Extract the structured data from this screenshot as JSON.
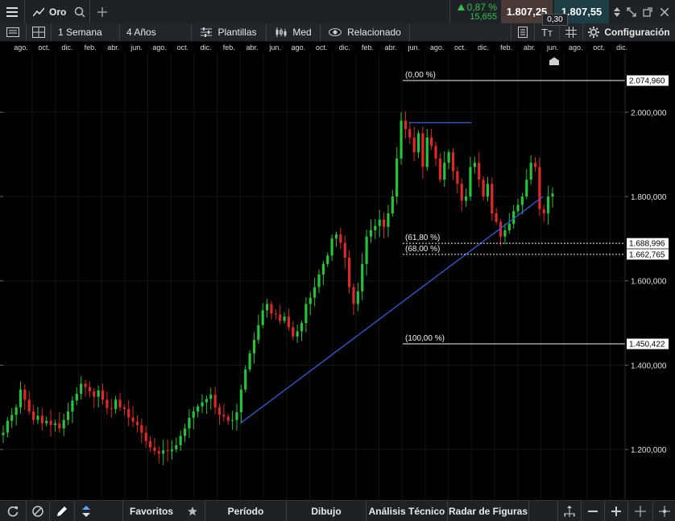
{
  "header": {
    "symbol": "Oro",
    "change_pct": "0,87 %",
    "change_abs": "15,655",
    "sell_price": "1.807,25",
    "buy_price": "1.807,55",
    "spread": "0,30"
  },
  "toolbar": {
    "interval": "1 Semana",
    "range": "4 Años",
    "templates": "Plantillas",
    "chart_type": "Med",
    "related": "Relacionado",
    "text_tool": "Tт",
    "settings": "Configuración"
  },
  "time_axis": {
    "labels": [
      "ago.",
      "oct.",
      "dic.",
      "feb.",
      "abr.",
      "jun.",
      "ago.",
      "oct.",
      "dic.",
      "feb.",
      "abr.",
      "jun.",
      "ago.",
      "oct.",
      "dic.",
      "feb.",
      "abr.",
      "jun.",
      "ago.",
      "oct.",
      "dic.",
      "feb.",
      "abr.",
      "jun.",
      "ago.",
      "oct.",
      "dic."
    ]
  },
  "chart_data": {
    "type": "candlestick",
    "ylim": [
      1080,
      2140
    ],
    "y_ticks": [
      "2.000,000",
      "1.800,000",
      "1.600,000",
      "1.400,000",
      "1.200,000"
    ],
    "y_tick_values": [
      2000,
      1800,
      1600,
      1400,
      1200
    ],
    "fib_levels": [
      {
        "label": "(0,00 %)",
        "price": 2074.96,
        "price_label": "2.074,960",
        "style": "solid"
      },
      {
        "label": "(61,80 %)",
        "price": 1688.996,
        "price_label": "1.688,996",
        "style": "dotted"
      },
      {
        "label": "(68,00 %)",
        "price": 1662.765,
        "price_label": "1.662,765",
        "style": "dotted"
      },
      {
        "label": "(100,00 %)",
        "price": 1450.422,
        "price_label": "1.450,422",
        "style": "solid"
      }
    ],
    "trendline": {
      "from": [
        0.385,
        1262
      ],
      "to": [
        0.87,
        1800
      ]
    },
    "resistance_line": {
      "from": [
        0.655,
        1975
      ],
      "to": [
        0.755,
        1975
      ]
    },
    "closes": [
      1240,
      1268,
      1282,
      1300,
      1342,
      1318,
      1290,
      1270,
      1280,
      1262,
      1268,
      1258,
      1262,
      1250,
      1270,
      1290,
      1316,
      1332,
      1356,
      1348,
      1338,
      1325,
      1340,
      1318,
      1298,
      1296,
      1318,
      1300,
      1296,
      1276,
      1266,
      1258,
      1240,
      1220,
      1205,
      1196,
      1190,
      1198,
      1196,
      1200,
      1210,
      1232,
      1250,
      1275,
      1290,
      1302,
      1312,
      1320,
      1330,
      1300,
      1282,
      1278,
      1268,
      1270,
      1288,
      1342,
      1390,
      1428,
      1460,
      1495,
      1530,
      1545,
      1522,
      1520,
      1505,
      1515,
      1490,
      1468,
      1480,
      1500,
      1545,
      1560,
      1585,
      1615,
      1640,
      1660,
      1700,
      1710,
      1690,
      1655,
      1585,
      1545,
      1575,
      1640,
      1705,
      1720,
      1730,
      1745,
      1728,
      1760,
      1800,
      1890,
      1980,
      1960,
      1940,
      1905,
      1950,
      1870,
      1940,
      1920,
      1890,
      1840,
      1880,
      1905,
      1860,
      1830,
      1790,
      1800,
      1870,
      1880,
      1840,
      1800,
      1830,
      1760,
      1740,
      1705,
      1720,
      1735,
      1765,
      1780,
      1800,
      1840,
      1880,
      1870,
      1770,
      1760,
      1800,
      1807
    ]
  },
  "bottom_bar": {
    "favorites": "Favoritos",
    "period": "Período",
    "drawing": "Dibujo",
    "technical": "Análisis Técnico",
    "patterns": "Radar de Figuras"
  }
}
